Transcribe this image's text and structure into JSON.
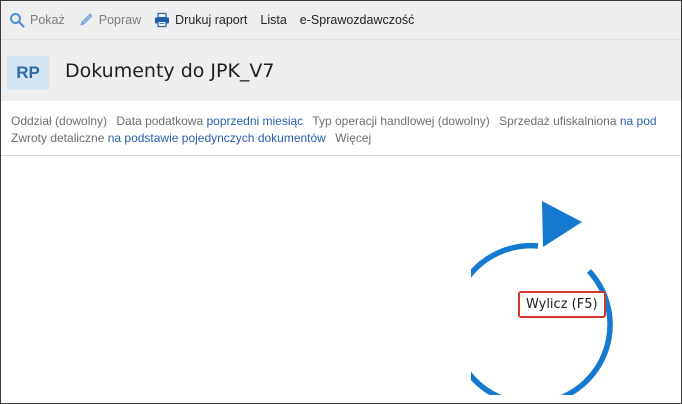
{
  "toolbar": {
    "show_label": "Pokaż",
    "edit_label": "Popraw",
    "print_label": "Drukuj raport",
    "list_label": "Lista",
    "ereport_label": "e-Sprawozdawczość"
  },
  "header": {
    "badge": "RP",
    "title": "Dokumenty do JPK_V7"
  },
  "filters": {
    "branch_label": "Oddział (dowolny)",
    "tax_date_label": "Data podatkowa",
    "tax_date_value": "poprzedni miesiąc",
    "operation_type_label": "Typ operacji handlowej (dowolny)",
    "fiscal_sales_label": "Sprzedaż ufiskalniona",
    "fiscal_sales_value": "na pod",
    "retail_returns_label": "Zwroty detaliczne",
    "retail_returns_value": "na podstawie pojedynczych dokumentów",
    "more_label": "Więcej"
  },
  "calc": {
    "button_label": "Wylicz (F5)"
  },
  "colors": {
    "accent_blue": "#1479cf",
    "link_blue": "#2a5fae",
    "highlight_red": "#d9352f",
    "toolbar_bg": "#eeeeee",
    "badge_bg": "#d4e4f3"
  }
}
